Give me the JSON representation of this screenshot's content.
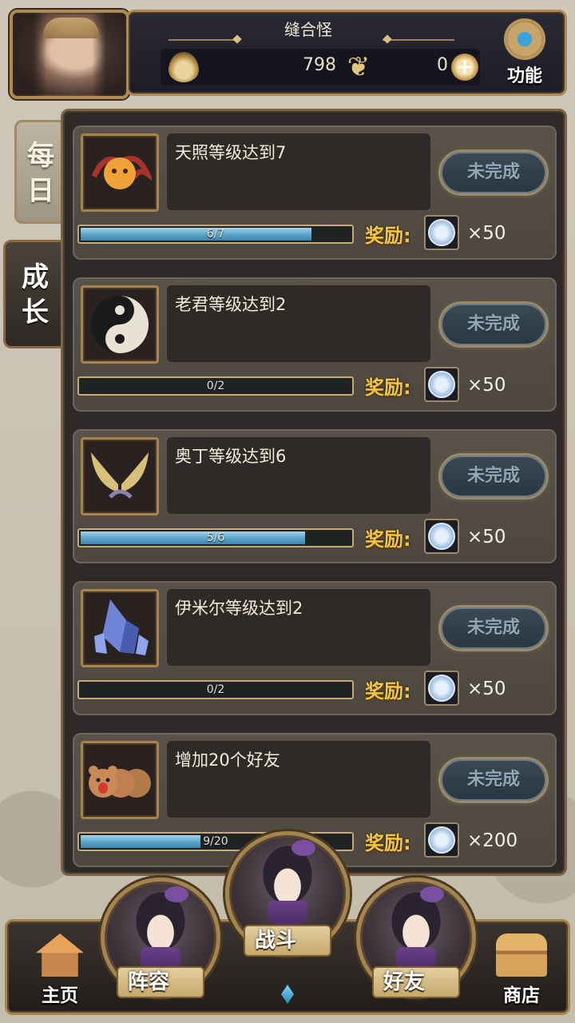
{
  "header": {
    "player_name": "缝合怪",
    "gold": "798",
    "gems": "0",
    "function_label": "功能"
  },
  "tabs": {
    "daily": "每日",
    "growth": "成长"
  },
  "quests": [
    {
      "title": "天照等级达到7",
      "progress_text": "6/7",
      "progress": 0.857,
      "status": "未完成",
      "reward_label": "奖励:",
      "reward_amount": "×50",
      "icon": "amaterasu-icon"
    },
    {
      "title": "老君等级达到2",
      "progress_text": "0/2",
      "progress": 0.0,
      "status": "未完成",
      "reward_label": "奖励:",
      "reward_amount": "×50",
      "icon": "yin-yang-icon"
    },
    {
      "title": "奥丁等级达到6",
      "progress_text": "5/6",
      "progress": 0.833,
      "status": "未完成",
      "reward_label": "奖励:",
      "reward_amount": "×50",
      "icon": "wings-icon"
    },
    {
      "title": "伊米尔等级达到2",
      "progress_text": "0/2",
      "progress": 0.0,
      "status": "未完成",
      "reward_label": "奖励:",
      "reward_amount": "×50",
      "icon": "crystal-icon"
    },
    {
      "title": "增加20个好友",
      "progress_text": "9/20",
      "progress": 0.45,
      "status": "未完成",
      "reward_label": "奖励:",
      "reward_amount": "×200",
      "icon": "bears-icon"
    }
  ],
  "bottom_nav": {
    "home": "主页",
    "lineup": "阵容",
    "battle": "战斗",
    "friends": "好友",
    "shop": "商店"
  },
  "colors": {
    "reward_label": "#f1c646",
    "progress_fill": "#5aa3c7",
    "frame_gold": "#a4844f"
  }
}
